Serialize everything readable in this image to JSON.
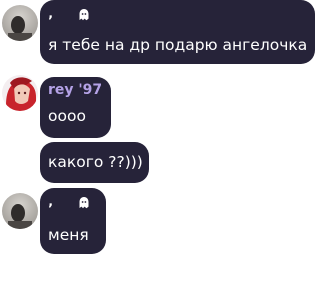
{
  "theme": {
    "bubble_color": "#262339",
    "text_color": "#ffffff",
    "sender_name_color": "#b4a2e6"
  },
  "messages": [
    {
      "sender_mark": "‚",
      "sender_icon": "ghost-icon",
      "text": "я тебе на др подарю ангелочка"
    },
    {
      "sender_name": "rey '97",
      "texts": [
        "оооо",
        "какого ??)))"
      ]
    },
    {
      "sender_mark": "‚",
      "sender_icon": "ghost-icon",
      "text": "меня"
    }
  ]
}
